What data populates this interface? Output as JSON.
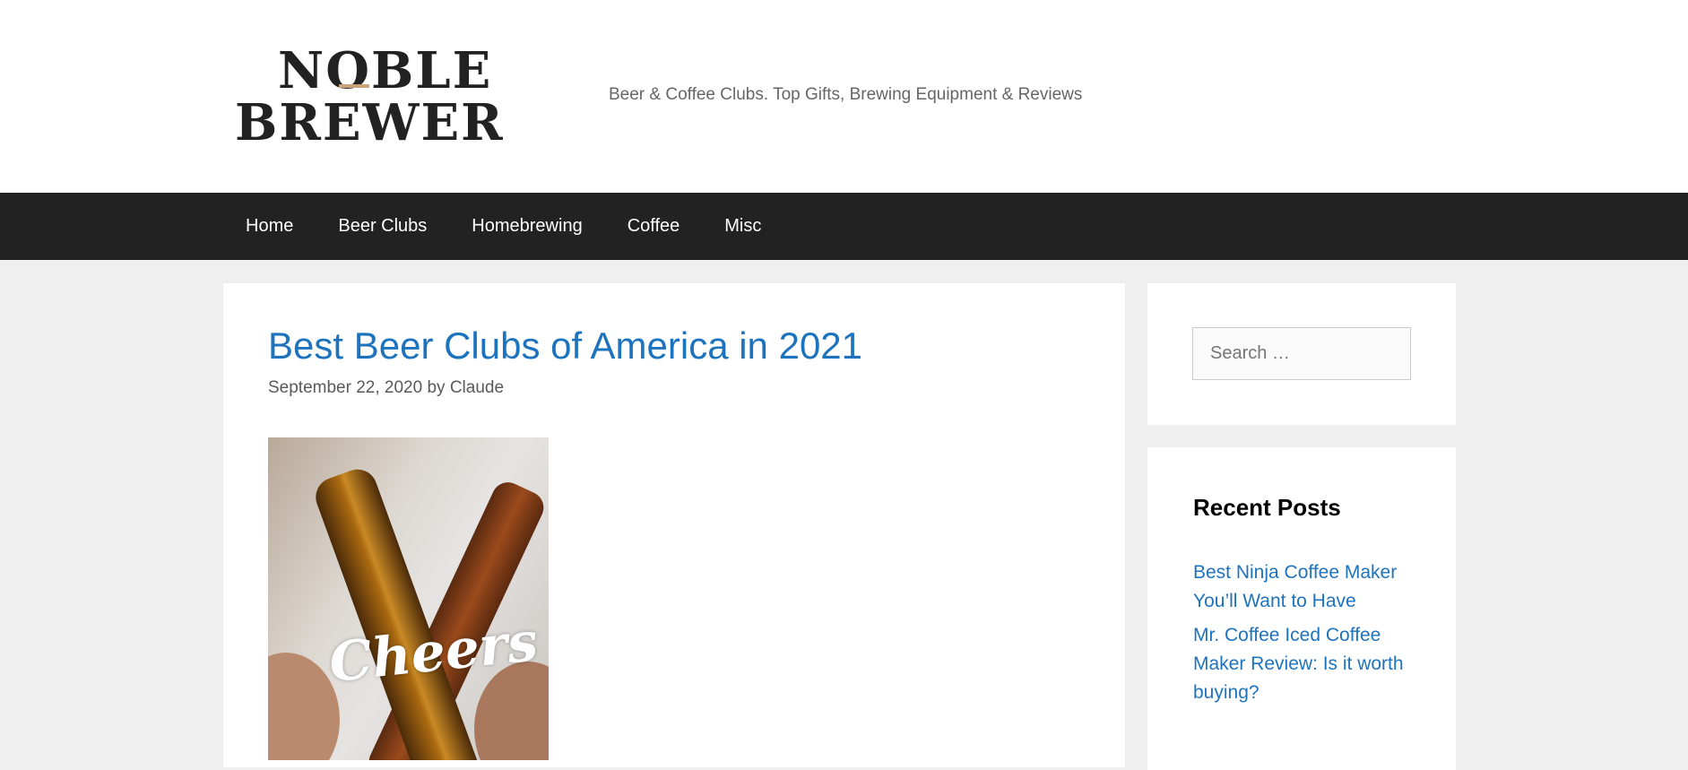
{
  "header": {
    "logo_line1": "NOBLE",
    "logo_line2": "BREWER",
    "tagline": "Beer & Coffee Clubs. Top Gifts, Brewing Equipment & Reviews"
  },
  "nav": {
    "items": [
      {
        "label": "Home"
      },
      {
        "label": "Beer Clubs"
      },
      {
        "label": "Homebrewing"
      },
      {
        "label": "Coffee"
      },
      {
        "label": "Misc"
      }
    ]
  },
  "post": {
    "title": "Best Beer Clubs of America in 2021",
    "date": "September 22, 2020",
    "by": "by",
    "author": "Claude",
    "image_text": "Cheers"
  },
  "sidebar": {
    "search": {
      "placeholder": "Search …"
    },
    "recent_posts": {
      "title": "Recent Posts",
      "items": [
        {
          "label": "Best Ninja Coffee Maker You’ll Want to Have"
        },
        {
          "label": "Mr. Coffee Iced Coffee Maker Review: Is it worth buying?"
        }
      ]
    }
  },
  "colors": {
    "link": "#1e73be",
    "nav_bg": "#222222",
    "page_bg": "#efefef",
    "logo_accent": "#c9a27a"
  }
}
